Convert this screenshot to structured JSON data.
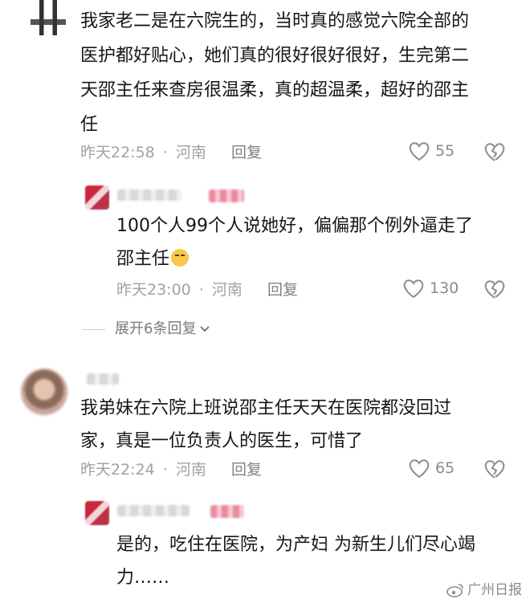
{
  "comments": [
    {
      "lines": [
        "我家老二是在六院生的，当时真的感觉六院全部的",
        "医护都好贴心，她们真的很好很好很好，生完第二",
        "天邵主任来查房很温柔，真的超温柔，超好的邵主",
        "任"
      ],
      "time": "昨天22:58",
      "location": "河南",
      "reply_label": "回复",
      "likes": "55"
    },
    {
      "lines": [
        "100个人99个人说她好，偏偏那个例外逼走了",
        "邵主任"
      ],
      "time": "昨天23:00",
      "location": "河南",
      "reply_label": "回复",
      "likes": "130"
    },
    {
      "lines": [
        "我弟妹在六院上班说邵主任天天在医院都没回过",
        "家，真是一位负责人的医生，可惜了"
      ],
      "time": "昨天22:24",
      "location": "河南",
      "reply_label": "回复",
      "likes": "65"
    },
    {
      "lines": [
        "是的，吃住在医院，为产妇 为新生儿们尽心竭",
        "力……"
      ]
    }
  ],
  "expand_label": "展开6条回复",
  "separator": "·",
  "watermark": "广州日报",
  "colors": {
    "text": "#161616",
    "meta": "#a2a2a2",
    "icon": "#9a9a9a"
  },
  "icons": [
    "heart-icon",
    "heart-broken-icon",
    "chevron-down-icon",
    "crying-emoji",
    "weibo-logo"
  ]
}
